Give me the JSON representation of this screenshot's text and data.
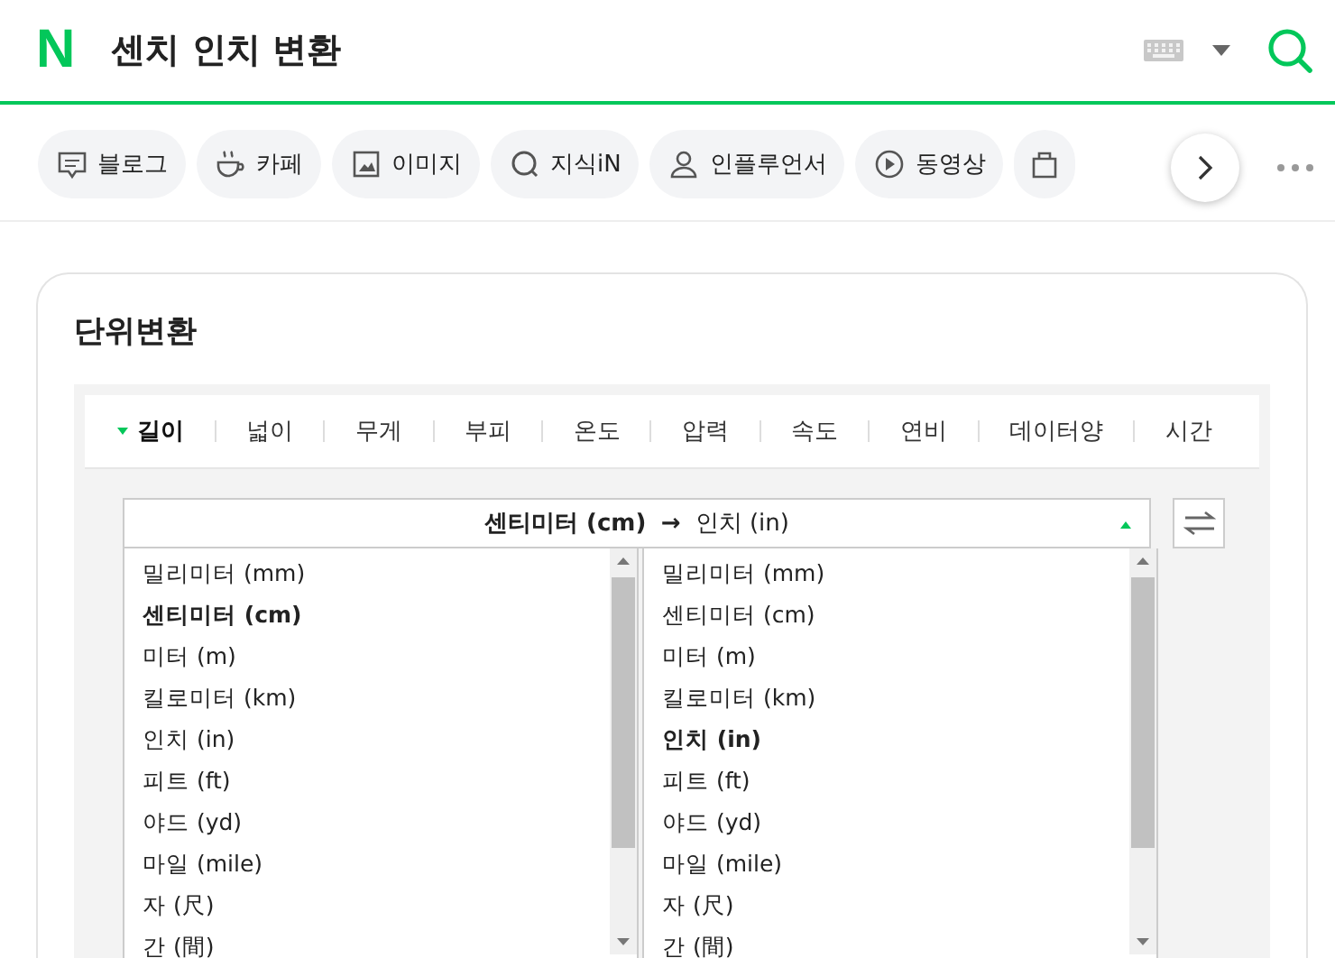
{
  "header": {
    "logo": "N",
    "query": "센치 인치 변환"
  },
  "chips": [
    {
      "kind": "blog",
      "label": "블로그"
    },
    {
      "kind": "cafe",
      "label": "카페"
    },
    {
      "kind": "image",
      "label": "이미지"
    },
    {
      "kind": "kin",
      "label": "지식iN"
    },
    {
      "kind": "influencer",
      "label": "인플루언서"
    },
    {
      "kind": "video",
      "label": "동영상"
    },
    {
      "kind": "shopping"
    }
  ],
  "card": {
    "title": "단위변환",
    "tabs": [
      {
        "label": "길이",
        "selected": true
      },
      {
        "label": "넓이",
        "selected": false
      },
      {
        "label": "무게",
        "selected": false
      },
      {
        "label": "부피",
        "selected": false
      },
      {
        "label": "온도",
        "selected": false
      },
      {
        "label": "압력",
        "selected": false
      },
      {
        "label": "속도",
        "selected": false
      },
      {
        "label": "연비",
        "selected": false
      },
      {
        "label": "데이터양",
        "selected": false
      },
      {
        "label": "시간",
        "selected": false
      }
    ],
    "select": {
      "from": "센티미터 (cm)",
      "arrow": "→",
      "to": "인치 (in)"
    },
    "lists": [
      {
        "items": [
          {
            "label": "밀리미터 (mm)",
            "selected": false
          },
          {
            "label": "센티미터 (cm)",
            "selected": true
          },
          {
            "label": "미터 (m)",
            "selected": false
          },
          {
            "label": "킬로미터 (km)",
            "selected": false
          },
          {
            "label": "인치 (in)",
            "selected": false
          },
          {
            "label": "피트 (ft)",
            "selected": false
          },
          {
            "label": "야드 (yd)",
            "selected": false
          },
          {
            "label": "마일 (mile)",
            "selected": false
          },
          {
            "label": "자 (尺)",
            "selected": false
          },
          {
            "label": "간 (間)",
            "selected": false
          }
        ]
      },
      {
        "items": [
          {
            "label": "밀리미터 (mm)",
            "selected": false
          },
          {
            "label": "센티미터 (cm)",
            "selected": false
          },
          {
            "label": "미터 (m)",
            "selected": false
          },
          {
            "label": "킬로미터 (km)",
            "selected": false
          },
          {
            "label": "인치 (in)",
            "selected": true
          },
          {
            "label": "피트 (ft)",
            "selected": false
          },
          {
            "label": "야드 (yd)",
            "selected": false
          },
          {
            "label": "마일 (mile)",
            "selected": false
          },
          {
            "label": "자 (尺)",
            "selected": false
          },
          {
            "label": "간 (間)",
            "selected": false
          }
        ]
      }
    ]
  }
}
